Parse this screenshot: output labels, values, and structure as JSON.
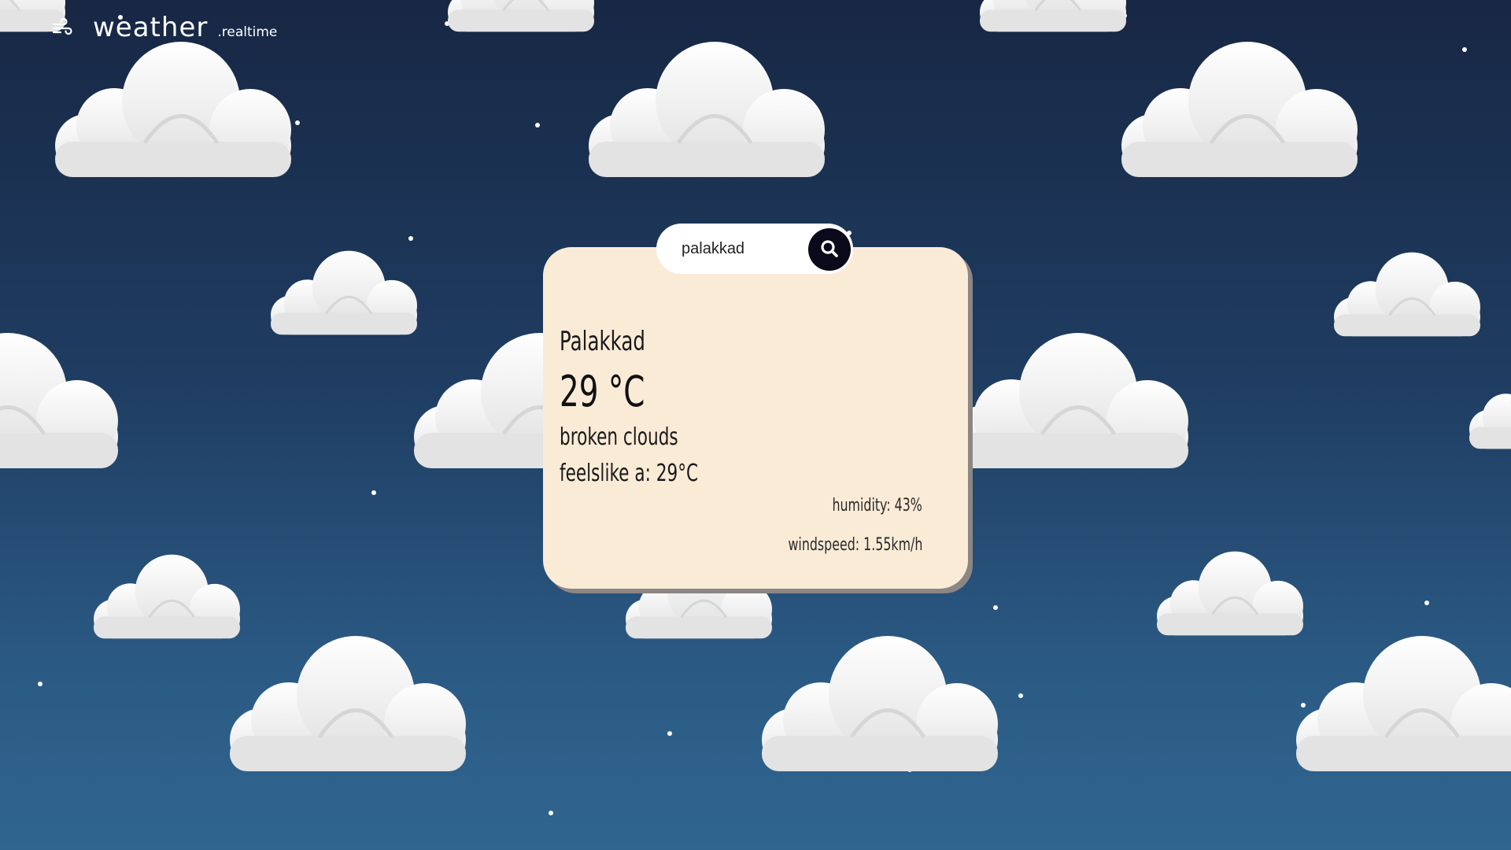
{
  "header": {
    "brand": "weather",
    "brand_suffix": ".realtime",
    "menu_icon": "wind-icon"
  },
  "search": {
    "value": "palakkad",
    "button_icon": "search-icon"
  },
  "weather": {
    "city": "Palakkad",
    "temperature": "29 °C",
    "description": "broken clouds",
    "feels_like": "feelslike a: 29°C",
    "humidity": "humidity: 43%",
    "windspeed": "windspeed: 1.55km/h"
  },
  "colors": {
    "sky_top": "#172744",
    "sky_bottom": "#2f658f",
    "card_background": "#faebd7",
    "search_button": "#0a0a1a"
  }
}
